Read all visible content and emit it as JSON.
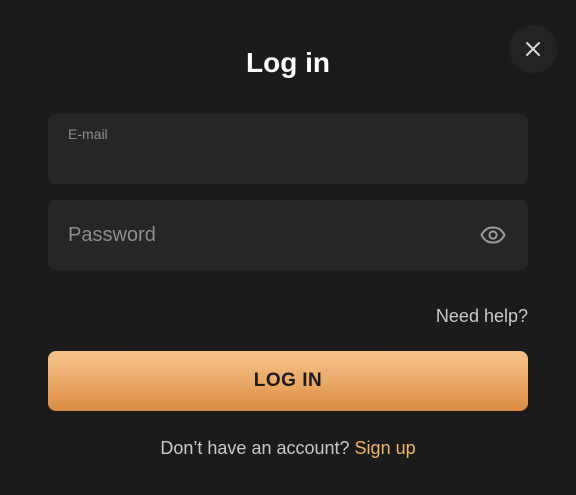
{
  "modal": {
    "title": "Log in",
    "close_icon": "close-icon"
  },
  "form": {
    "email": {
      "label": "E-mail",
      "value": ""
    },
    "password": {
      "placeholder": "Password",
      "value": "",
      "toggle_icon": "eye-icon"
    },
    "need_help": "Need help?",
    "submit_label": "LOG IN"
  },
  "footer": {
    "prompt": "Don’t have an account?",
    "signup_link": "Sign up"
  },
  "colors": {
    "background": "#1b1b1b",
    "field_background": "#262626",
    "button_gradient_top": "#f4c48c",
    "button_gradient_bottom": "#d98a3f",
    "link_accent": "#f0b468",
    "muted_text": "#8d8d8d"
  }
}
